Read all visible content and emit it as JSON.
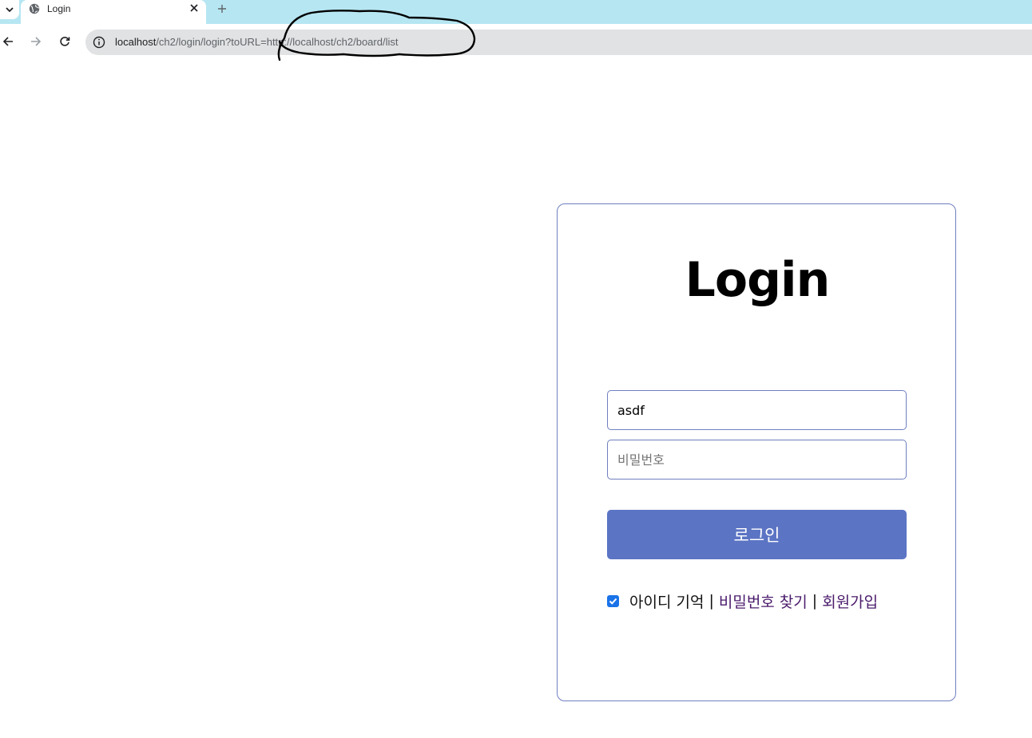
{
  "browser": {
    "tab_title": "Login",
    "url_host": "localhost",
    "url_path": "/ch2/login/login?toURL=http://localhost/ch2/board/list",
    "icons": {
      "tab_menu": "chevron-down-icon",
      "favicon": "globe-icon",
      "close_tab": "close-icon",
      "new_tab": "plus-icon",
      "back": "back-arrow-icon",
      "forward": "forward-arrow-icon",
      "reload": "reload-icon",
      "site_info": "info-icon"
    }
  },
  "login": {
    "heading": "Login",
    "id_value": "asdf",
    "password_placeholder": "비밀번호",
    "submit_label": "로그인",
    "remember_checked": true,
    "remember_label": "아이디 기억",
    "separator": "|",
    "find_password_label": "비밀번호 찾기",
    "signup_label": "회원가입"
  },
  "colors": {
    "tabstrip": "#b6e6f2",
    "card_border": "#6f7fc0",
    "button": "#5b74c4",
    "link": "#4a1a6b",
    "checkbox": "#1a73e8"
  }
}
